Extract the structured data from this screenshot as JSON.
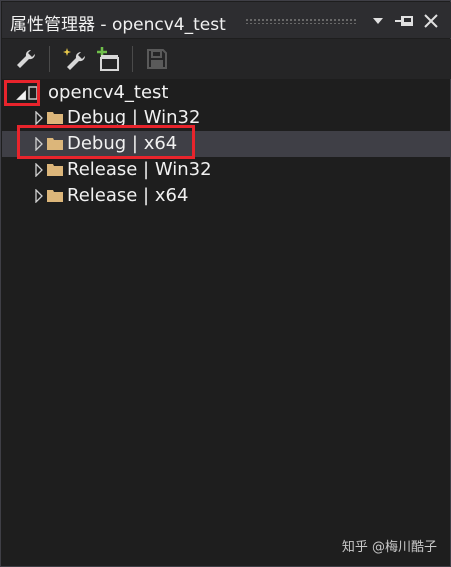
{
  "window": {
    "title": "属性管理器 - opencv4_test"
  },
  "titlebar_buttons": [
    {
      "icon": "dropdown-arrow-icon"
    },
    {
      "icon": "pin-icon"
    },
    {
      "icon": "close-icon"
    }
  ],
  "toolbar": {
    "items": [
      {
        "icon": "wrench-properties-icon"
      },
      {
        "icon": "new-property-sheet-icon"
      },
      {
        "icon": "add-existing-property-sheet-icon"
      },
      {
        "icon": "save-icon",
        "disabled": true
      }
    ]
  },
  "tree": {
    "root": {
      "label": "opencv4_test",
      "expanded": true
    },
    "children": [
      {
        "label": "Debug | Win32",
        "expanded": false,
        "selected": false
      },
      {
        "label": "Debug | x64",
        "expanded": false,
        "selected": true
      },
      {
        "label": "Release | Win32",
        "expanded": false,
        "selected": false
      },
      {
        "label": "Release | x64",
        "expanded": false,
        "selected": false
      }
    ]
  },
  "colors": {
    "background": "#1e1e1e",
    "titlebar": "#2d2d30",
    "selection": "#3f3f46",
    "annotation": "#e8242c",
    "folder": "#dcb67a"
  },
  "watermark": "知乎 @梅川酷子"
}
